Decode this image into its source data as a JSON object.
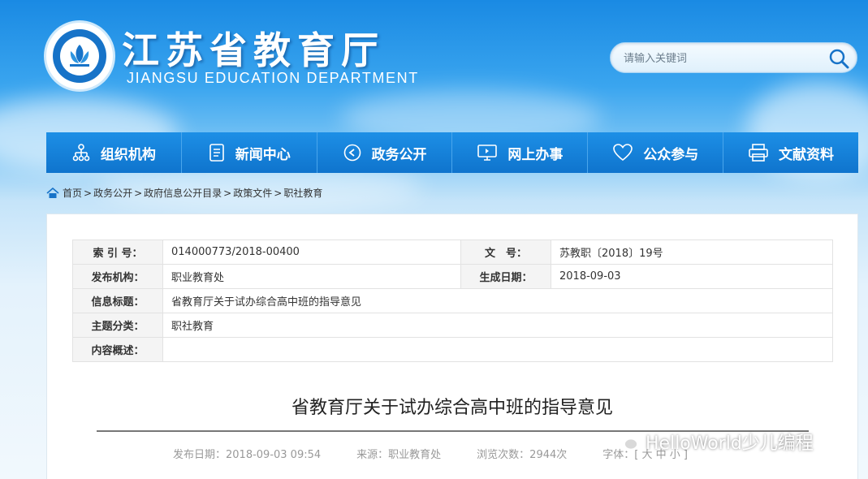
{
  "header": {
    "title_cn": "江苏省教育厅",
    "title_en": "JIANGSU EDUCATION DEPARTMENT"
  },
  "search": {
    "placeholder": "请输入关键词",
    "icon": "search-icon"
  },
  "nav": [
    {
      "label": "组织机构",
      "icon": "org-chart-icon"
    },
    {
      "label": "新闻中心",
      "icon": "document-icon"
    },
    {
      "label": "政务公开",
      "icon": "play-circle-icon"
    },
    {
      "label": "网上办事",
      "icon": "monitor-icon"
    },
    {
      "label": "公众参与",
      "icon": "heart-icon"
    },
    {
      "label": "文献资料",
      "icon": "printer-icon"
    }
  ],
  "breadcrumb": {
    "icon": "home-icon",
    "items": [
      "首页",
      "政务公开",
      "政府信息公开目录",
      "政策文件",
      "职社教育"
    ],
    "separator": ">"
  },
  "meta": {
    "index_label": "索 引 号：",
    "index_value": "014000773/2018-00400",
    "docno_label": "文　号：",
    "docno_value": "苏教职〔2018〕19号",
    "publisher_label": "发布机构：",
    "publisher_value": "职业教育处",
    "date_label": "生成日期：",
    "date_value": "2018-09-03",
    "title_label": "信息标题：",
    "title_value": "省教育厅关于试办综合高中班的指导意见",
    "category_label": "主题分类：",
    "category_value": "职社教育",
    "summary_label": "内容概述：",
    "summary_value": ""
  },
  "article": {
    "title": "省教育厅关于试办综合高中班的指导意见",
    "published": "发布日期：2018-09-03 09:54",
    "source": "来源：职业教育处",
    "views": "浏览次数：2944次",
    "font_size": "字体：[ 大 中 小 ]"
  },
  "watermark": "HelloWorld少儿编程",
  "colors": {
    "nav_bg": "#1081d8",
    "brand_blue": "#1773c8"
  }
}
